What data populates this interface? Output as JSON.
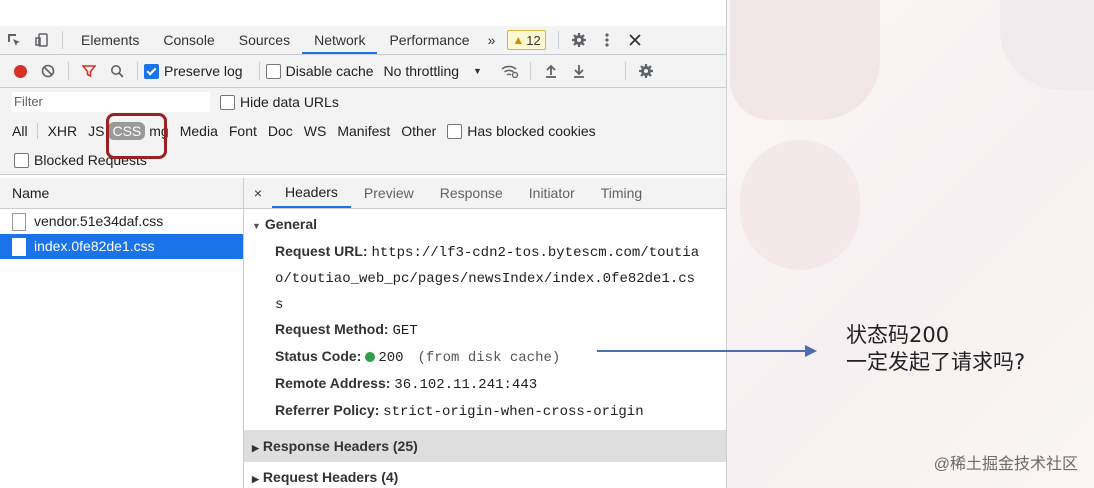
{
  "devtools": {
    "tabs": [
      "Elements",
      "Console",
      "Sources",
      "Network",
      "Performance"
    ],
    "active_tab": "Network",
    "more_tabs": "»",
    "warning_count": "12",
    "toolbar": {
      "preserve_log": "Preserve log",
      "disable_cache": "Disable cache",
      "throttling": "No throttling",
      "throttling_caret": "▼"
    },
    "filter": {
      "placeholder": "Filter",
      "hide_data_urls": "Hide data URLs"
    },
    "types": [
      "All",
      "XHR",
      "JS",
      "CSS",
      "Img",
      "Media",
      "Font",
      "Doc",
      "WS",
      "Manifest",
      "Other"
    ],
    "types_display": {
      "all": "All",
      "xhr": "XHR",
      "js": "JS",
      "css": "CSS",
      "img": "mg",
      "media": "Media",
      "font": "Font",
      "doc": "Doc",
      "ws": "WS",
      "manifest": "Manifest",
      "other": "Other"
    },
    "has_blocked_cookies": "Has blocked cookies",
    "blocked_requests": "Blocked Requests",
    "list": {
      "header": "Name",
      "rows": [
        "vendor.51e34daf.css",
        "index.0fe82de1.css"
      ],
      "selected_index": 1
    },
    "detail": {
      "close": "×",
      "tabs": [
        "Headers",
        "Preview",
        "Response",
        "Initiator",
        "Timing"
      ],
      "active_tab": "Headers",
      "general": {
        "title": "General",
        "request_url_label": "Request URL:",
        "request_url_line1": "https://lf3-cdn2-tos.bytescm.com/toutia",
        "request_url_line2": "o/toutiao_web_pc/pages/newsIndex/index.0fe82de1.cs",
        "request_url_line3": "s",
        "request_method_label": "Request Method:",
        "request_method": "GET",
        "status_code_label": "Status Code:",
        "status_code": "200",
        "status_note": "(from disk cache)",
        "remote_address_label": "Remote Address:",
        "remote_address": "36.102.11.241:443",
        "referrer_policy_label": "Referrer Policy:",
        "referrer_policy": "strict-origin-when-cross-origin"
      },
      "response_headers": "Response Headers (25)",
      "request_headers": "Request Headers (4)"
    }
  },
  "annotation": {
    "line1": "状态码200",
    "line2": "一定发起了请求吗?"
  },
  "footer": "@稀土掘金技术社区",
  "colors": {
    "accent": "#1a73e8",
    "highlight_box": "#9c1f22",
    "status_ok": "#2e9e44",
    "arrow": "#4a6fb0"
  }
}
